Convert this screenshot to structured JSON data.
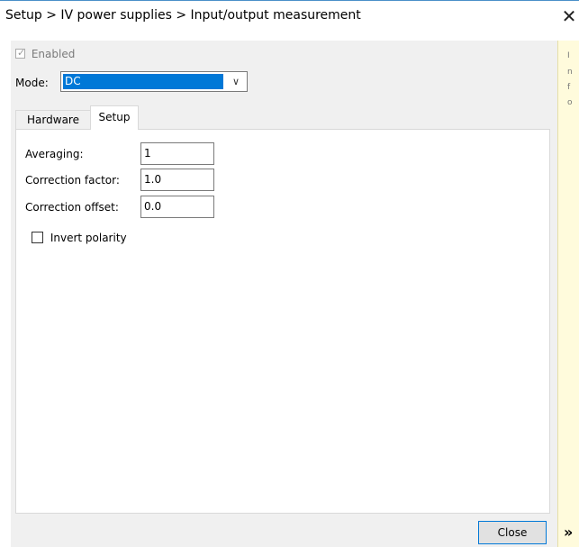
{
  "window": {
    "title": "Setup > IV power supplies > Input/output measurement",
    "close_glyph": "✕"
  },
  "enabled": {
    "label": "Enabled",
    "checked": true,
    "disabled": true
  },
  "mode": {
    "label": "Mode:",
    "value": "DC",
    "arrow_glyph": "∨"
  },
  "tabs": [
    {
      "label": "Hardware",
      "active": false
    },
    {
      "label": "Setup",
      "active": true
    }
  ],
  "setup": {
    "fields": [
      {
        "label": "Averaging:",
        "value": "1"
      },
      {
        "label": "Correction factor:",
        "value": "1.0"
      },
      {
        "label": "Correction offset:",
        "value": "0.0"
      }
    ],
    "invert_polarity": {
      "label": "Invert polarity",
      "checked": false
    }
  },
  "buttons": {
    "close_label": "Close"
  },
  "side_panel": {
    "hint_lines": [
      "I",
      "n",
      "f",
      "o"
    ],
    "expand_glyph": "»",
    "background": "#fffbdc"
  },
  "colors": {
    "accent": "#0078d7",
    "title_accent_line": "#4a90c8"
  }
}
